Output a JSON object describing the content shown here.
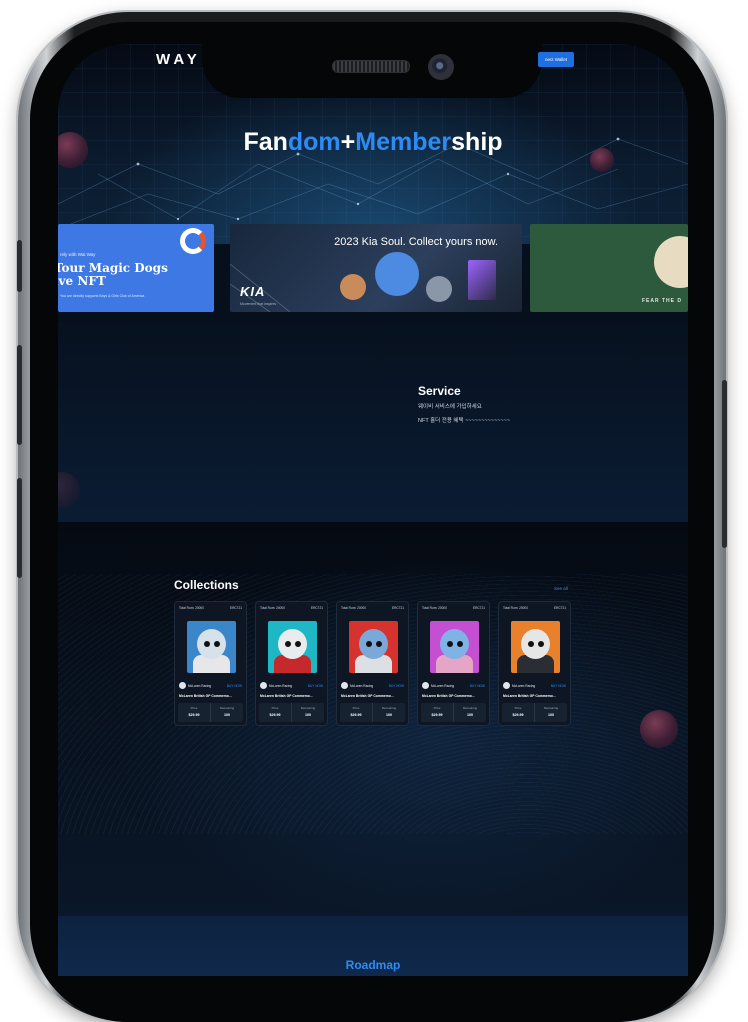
{
  "header": {
    "brand": "WAY",
    "connect_label": "nect Wallet"
  },
  "hero": {
    "title_parts": [
      "Fan",
      "dom",
      "+",
      "Member",
      "ship"
    ]
  },
  "banners": [
    {
      "small_text": "rely with Wai Way",
      "title_line1": "Tour Magic Dogs",
      "title_line2": "ive NFT",
      "footer": "You are directly supports Boys & Girls Club of America"
    },
    {
      "headline": "2023 Kia Soul. Collect yours now.",
      "logo_text": "KIA",
      "tagline": "Movement that inspires"
    },
    {
      "tagline": "FEAR THE D"
    }
  ],
  "service": {
    "title": "Service",
    "line1": "웨이비 서비스에 가입하세요",
    "line2": "NFT 홀더 전용 혜택 ~~~~~~~~~~~~~~"
  },
  "collections": {
    "title": "Collections",
    "see_all": "See all",
    "cards": [
      {
        "total": "Total Rum: 20000",
        "standard": "ERC721",
        "brand": "McLaren Racing",
        "buy": "BUY NOW",
        "name": "McLaren British GP Commemo...",
        "price_label": "Price",
        "price": "$29.99",
        "remaining_label": "Remaining",
        "remaining": "100",
        "bg": "#3a86c8",
        "head": "#d7e1ea",
        "body": "#e7e7ea"
      },
      {
        "total": "Total Rum: 20000",
        "standard": "ERC721",
        "brand": "McLaren Racing",
        "buy": "BUY NOW",
        "name": "McLaren British GP Commemo...",
        "price_label": "Price",
        "price": "$29.99",
        "remaining_label": "Remaining",
        "remaining": "100",
        "bg": "#1fb7c4",
        "head": "#e9ecef",
        "body": "#c6292c"
      },
      {
        "total": "Total Rum: 20000",
        "standard": "ERC721",
        "brand": "McLaren Racing",
        "buy": "BUY NOW",
        "name": "McLaren British GP Commemo...",
        "price_label": "Price",
        "price": "$29.99",
        "remaining_label": "Remaining",
        "remaining": "100",
        "bg": "#d6322e",
        "head": "#7aa8d8",
        "body": "#dcdfe4"
      },
      {
        "total": "Total Rum: 20000",
        "standard": "ERC721",
        "brand": "McLaren Racing",
        "buy": "BUY NOW",
        "name": "McLaren British GP Commemo...",
        "price_label": "Price",
        "price": "$29.99",
        "remaining_label": "Remaining",
        "remaining": "100",
        "bg": "#c44fd0",
        "head": "#7fb3e6",
        "body": "#e3a6c7"
      },
      {
        "total": "Total Rum: 20000",
        "standard": "ERC721",
        "brand": "McLaren Racing",
        "buy": "BUY NOW",
        "name": "McLaren British GP Commemo...",
        "price_label": "Price",
        "price": "$29.99",
        "remaining_label": "Remaining",
        "remaining": "100",
        "bg": "#e9802c",
        "head": "#e6e6e6",
        "body": "#2a2d33"
      }
    ]
  },
  "roadmap": {
    "title": "Roadmap"
  },
  "colors": {
    "accent": "#2e8bf5",
    "background": "#06101d"
  }
}
